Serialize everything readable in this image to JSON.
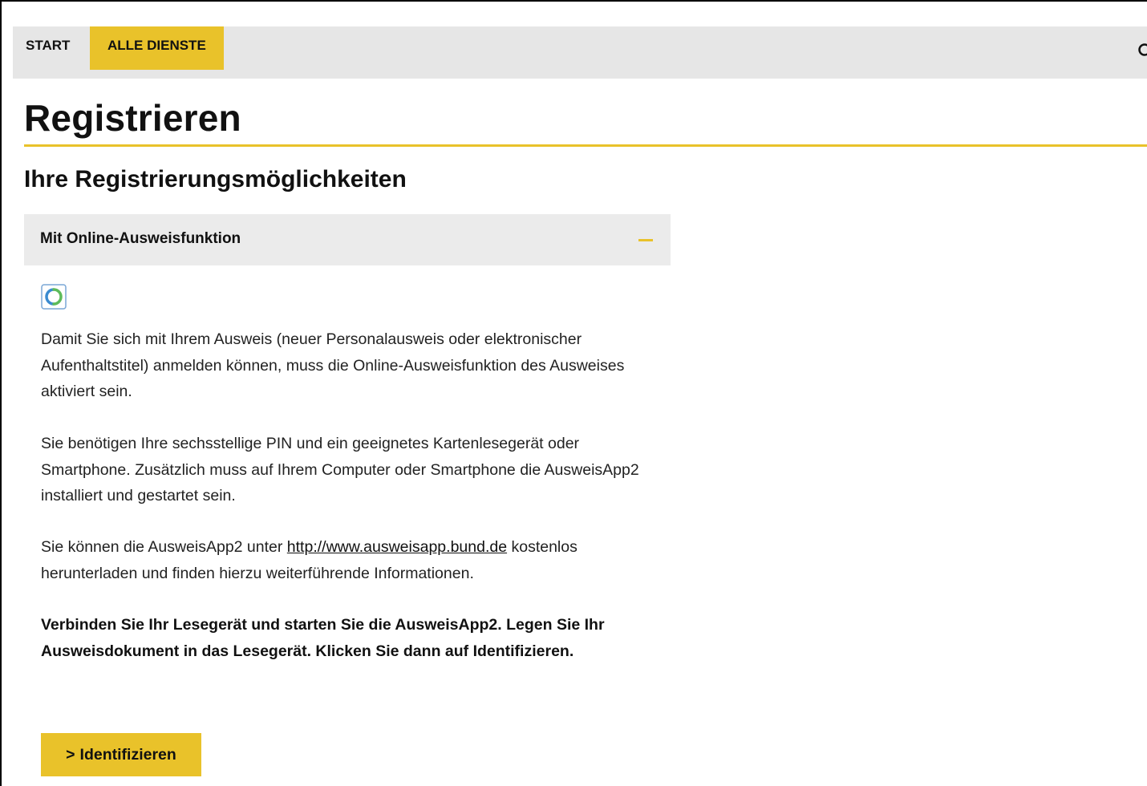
{
  "nav": {
    "items": [
      {
        "label": "START",
        "active": false
      },
      {
        "label": "ALLE DIENSTE",
        "active": true
      }
    ],
    "search_icon": "search-icon"
  },
  "page": {
    "title": "Registrieren",
    "section_title": "Ihre Registrierungsmöglichkeiten"
  },
  "accordion": {
    "title": "Mit Online-Ausweisfunktion",
    "toggle_icon": "minus-icon",
    "expanded": true,
    "logo_icon": "ausweisapp-logo-icon",
    "paragraph1": "Damit Sie sich mit Ihrem Ausweis (neuer Personalausweis oder elektronischer Aufenthaltstitel) anmelden können, muss die Online-Ausweisfunktion des Ausweises aktiviert sein.",
    "paragraph2": "Sie benötigen Ihre sechsstellige PIN und ein geeignetes Kartenlesegerät oder Smartphone. Zusätzlich muss auf Ihrem Computer oder Smartphone die AusweisApp2 installiert und gestartet sein.",
    "paragraph3_before": "Sie können die AusweisApp2 unter ",
    "paragraph3_link": "http://www.ausweisapp.bund.de",
    "paragraph3_after": " kostenlos herunterladen und finden hierzu weiterführende Informationen.",
    "instruction": "Verbinden Sie Ihr Lesegerät und starten Sie die AusweisApp2. Legen Sie Ihr Ausweisdokument in das Lesegerät. Klicken Sie dann auf Identifizieren.",
    "button_chevron": ">",
    "button_label": "Identifizieren"
  },
  "colors": {
    "accent": "#e9c22a",
    "nav_background": "#e6e6e6",
    "accordion_background": "#ebebeb"
  }
}
